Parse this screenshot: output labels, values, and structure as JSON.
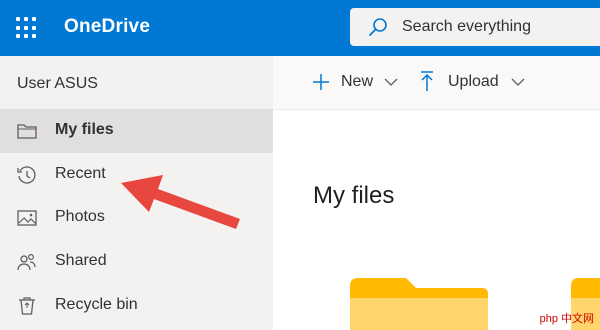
{
  "app": {
    "name": "OneDrive"
  },
  "search": {
    "placeholder": "Search everything"
  },
  "sidebar": {
    "user": "User ASUS",
    "items": [
      {
        "label": "My files",
        "icon": "folder-icon",
        "active": true
      },
      {
        "label": "Recent",
        "icon": "history-icon",
        "active": false
      },
      {
        "label": "Photos",
        "icon": "photo-icon",
        "active": false
      },
      {
        "label": "Shared",
        "icon": "people-icon",
        "active": false
      },
      {
        "label": "Recycle bin",
        "icon": "recycle-bin-icon",
        "active": false
      }
    ]
  },
  "toolbar": {
    "new_label": "New",
    "upload_label": "Upload"
  },
  "main": {
    "title": "My files"
  },
  "watermark": "php 中文网",
  "colors": {
    "brand": "#0078d4",
    "sidebar_bg": "#f3f2f1",
    "active_item": "#e1dfdd",
    "annotation_arrow": "#e8473f",
    "folder": "#ffd66b"
  }
}
